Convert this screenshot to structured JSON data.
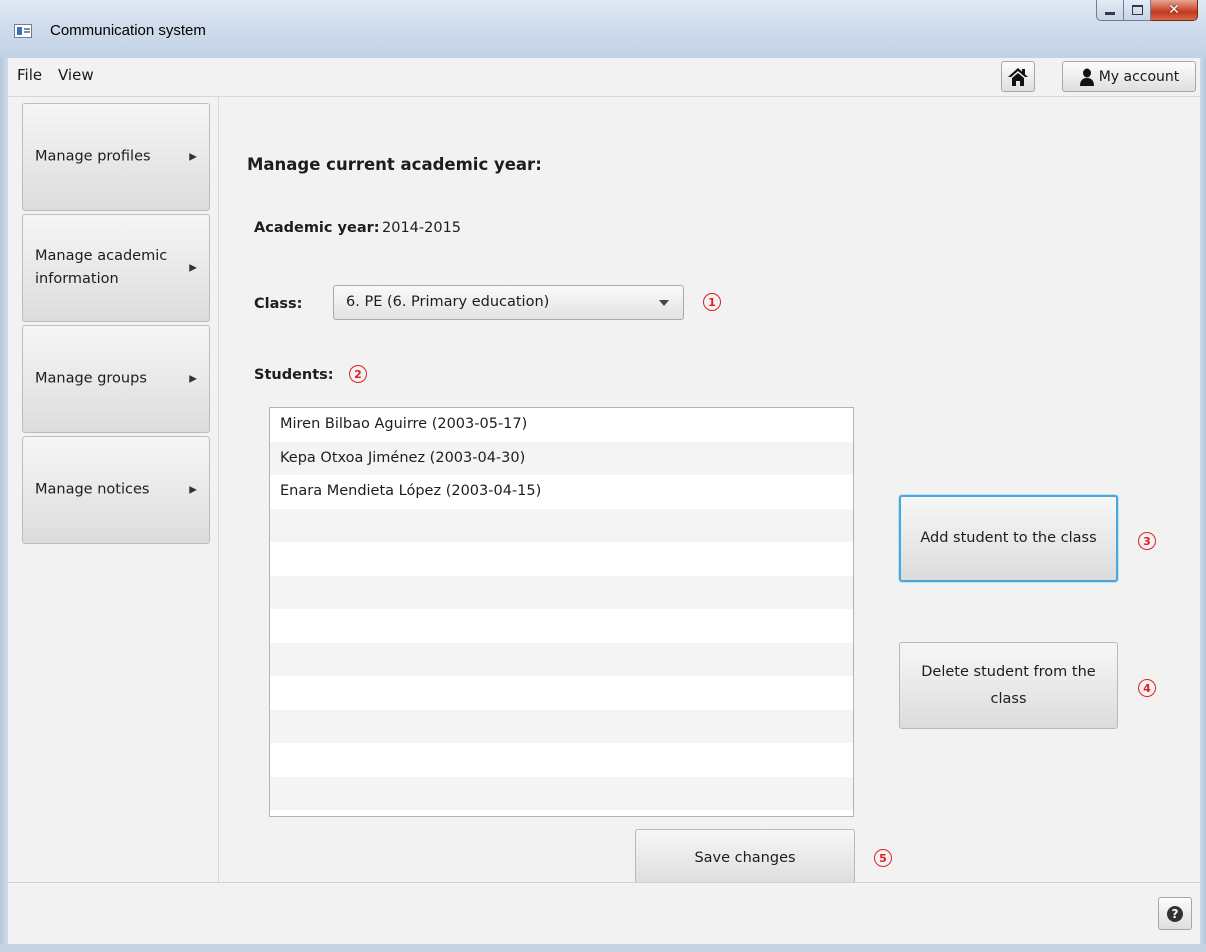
{
  "window": {
    "title": "Communication system"
  },
  "menubar": {
    "file": "File",
    "view": "View",
    "account_label": "My account"
  },
  "sidebar": {
    "items": [
      {
        "label": "Manage profiles"
      },
      {
        "label": "Manage academic information"
      },
      {
        "label": "Manage groups"
      },
      {
        "label": "Manage notices"
      }
    ]
  },
  "main": {
    "heading": "Manage current academic year:",
    "academic_year_label": "Academic year:",
    "academic_year_value": "2014-2015",
    "class_label": "Class:",
    "class_value": "6. PE (6. Primary education)",
    "students_label": "Students:",
    "students": [
      "Miren Bilbao Aguirre (2003-05-17)",
      "Kepa Otxoa Jiménez (2003-04-30)",
      "Enara Mendieta López (2003-04-15)"
    ],
    "add_button": "Add student to the class",
    "delete_button": "Delete student from the class",
    "save_button": "Save changes"
  },
  "markers": {
    "m1": "1",
    "m2": "2",
    "m3": "3",
    "m4": "4",
    "m5": "5"
  },
  "colors": {
    "marker": "#e02020",
    "focus": "#4aa7d8"
  }
}
